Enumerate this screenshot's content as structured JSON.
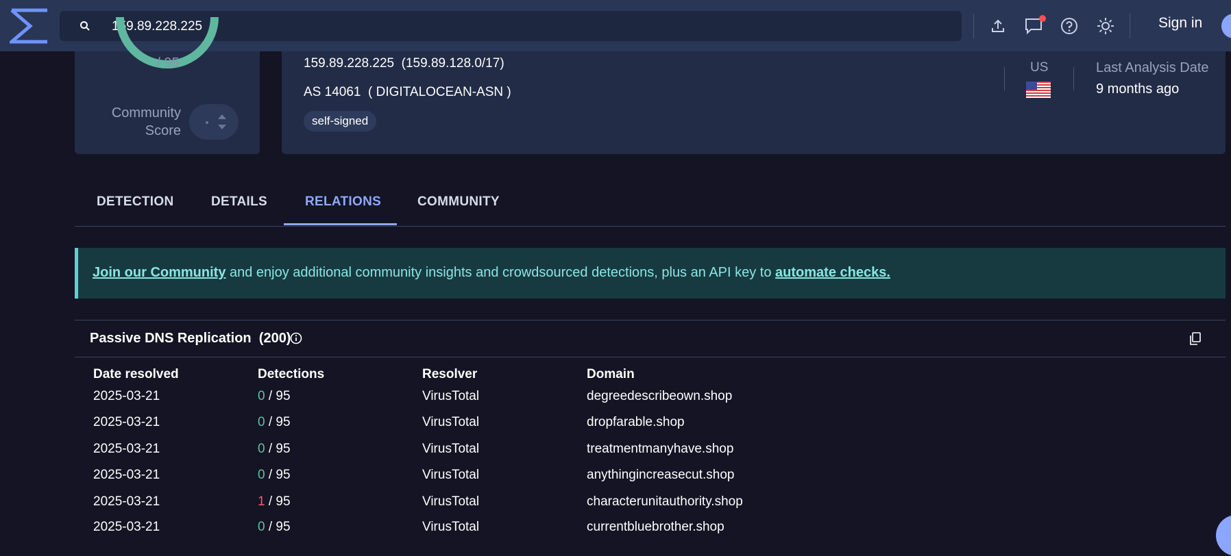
{
  "search": {
    "query": "159.89.228.225"
  },
  "topbar": {
    "signin_label": "Sign in"
  },
  "score": {
    "denominator": "/ 95",
    "community_label_line1": "Community",
    "community_label_line2": "Score"
  },
  "ip_info": {
    "ip": "159.89.228.225",
    "network": "(159.89.128.0/17)",
    "as_number": "AS 14061",
    "as_name": "( DIGITALOCEAN-ASN )",
    "tag": "self-signed",
    "country": "US",
    "last_analysis_label": "Last Analysis Date",
    "last_analysis_value": "9 months ago"
  },
  "tabs": [
    {
      "label": "DETECTION"
    },
    {
      "label": "DETAILS"
    },
    {
      "label": "RELATIONS"
    },
    {
      "label": "COMMUNITY"
    }
  ],
  "banner": {
    "link1": "Join our Community",
    "middle": " and enjoy additional community insights and crowdsourced detections, plus an API key to ",
    "link2": "automate checks."
  },
  "passive_dns": {
    "title": "Passive DNS Replication",
    "count": "(200)",
    "headers": [
      "Date resolved",
      "Detections",
      "Resolver",
      "Domain"
    ],
    "rows": [
      {
        "date": "2025-03-21",
        "det": "0",
        "total": " / 95",
        "resolver": "VirusTotal",
        "domain": "degreedescribeown.shop"
      },
      {
        "date": "2025-03-21",
        "det": "0",
        "total": " / 95",
        "resolver": "VirusTotal",
        "domain": "dropfarable.shop"
      },
      {
        "date": "2025-03-21",
        "det": "0",
        "total": " / 95",
        "resolver": "VirusTotal",
        "domain": "treatmentmanyhave.shop"
      },
      {
        "date": "2025-03-21",
        "det": "0",
        "total": " / 95",
        "resolver": "VirusTotal",
        "domain": "anythingincreasecut.shop"
      },
      {
        "date": "2025-03-21",
        "det": "1",
        "total": " / 95",
        "resolver": "VirusTotal",
        "domain": "characterunitauthority.shop"
      },
      {
        "date": "2025-03-21",
        "det": "0",
        "total": " / 95",
        "resolver": "VirusTotal",
        "domain": "currentbluebrother.shop"
      }
    ]
  },
  "colors": {
    "accent": "#8fa8ff",
    "ring": "#5fb7a0",
    "banner_bg": "#173a40",
    "banner_text": "#8ae6e3",
    "detection_zero": "#5fc2a0",
    "detection_positive": "#ff5a5a"
  },
  "icons": [
    "logo-icon",
    "search-icon",
    "upload-icon",
    "chat-icon",
    "help-icon",
    "theme-icon",
    "us-flag-icon",
    "info-icon",
    "copy-icon"
  ]
}
